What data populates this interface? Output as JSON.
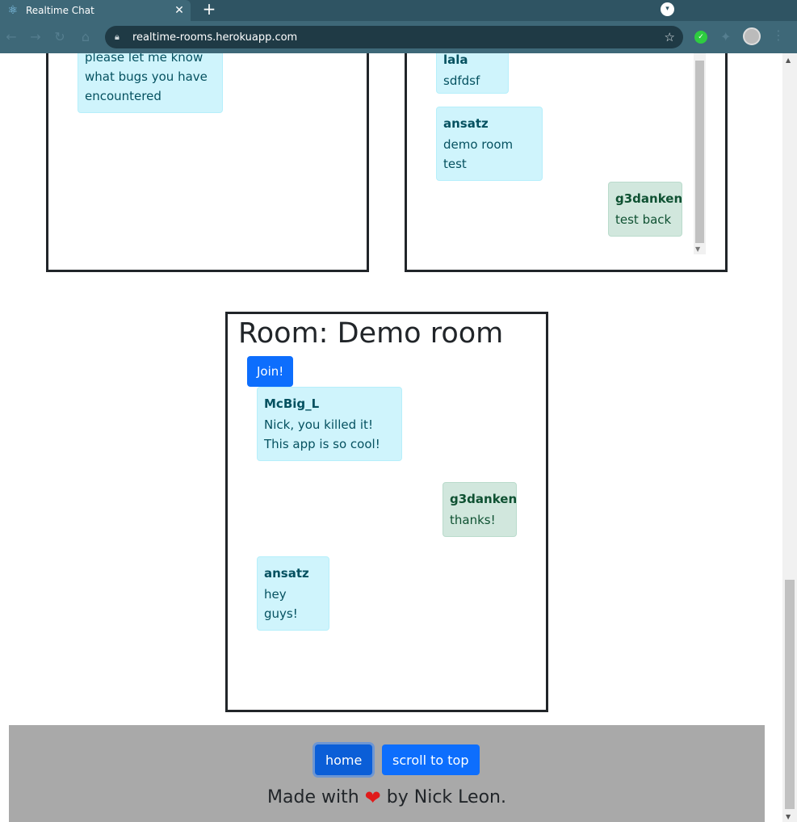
{
  "browser": {
    "tab_title": "Realtime Chat",
    "tab_close": "✕",
    "new_tab": "+",
    "url": "realtime-rooms.herokuapp.com"
  },
  "rooms_top": {
    "left": {
      "messages": [
        {
          "text": "please let me know what bugs you have encountered",
          "style": "info"
        }
      ]
    },
    "right": {
      "messages": [
        {
          "user": "lala",
          "text": "sdfdsf",
          "style": "info"
        },
        {
          "user": "ansatz",
          "text": "demo room test",
          "style": "info"
        },
        {
          "user": "g3danken",
          "text": "test back",
          "style": "success"
        }
      ]
    }
  },
  "demo_room": {
    "title": "Room: Demo room",
    "join_label": "Join!",
    "messages": [
      {
        "user": "McBig_L",
        "text": "Nick, you killed it! This app is so cool!",
        "style": "info"
      },
      {
        "user": "g3danken",
        "text": "thanks!",
        "style": "success"
      },
      {
        "user": "ansatz",
        "text": "hey guys!",
        "style": "info"
      }
    ]
  },
  "footer": {
    "home_label": "home",
    "scroll_top_label": "scroll to top",
    "credit_before": "Made with",
    "credit_after": "by Nick Leon."
  },
  "colors": {
    "primary": "#0d6efd",
    "info_bg": "#cff4fc",
    "success_bg": "#d1e7dd",
    "footer_bg": "#a9a9a9"
  }
}
